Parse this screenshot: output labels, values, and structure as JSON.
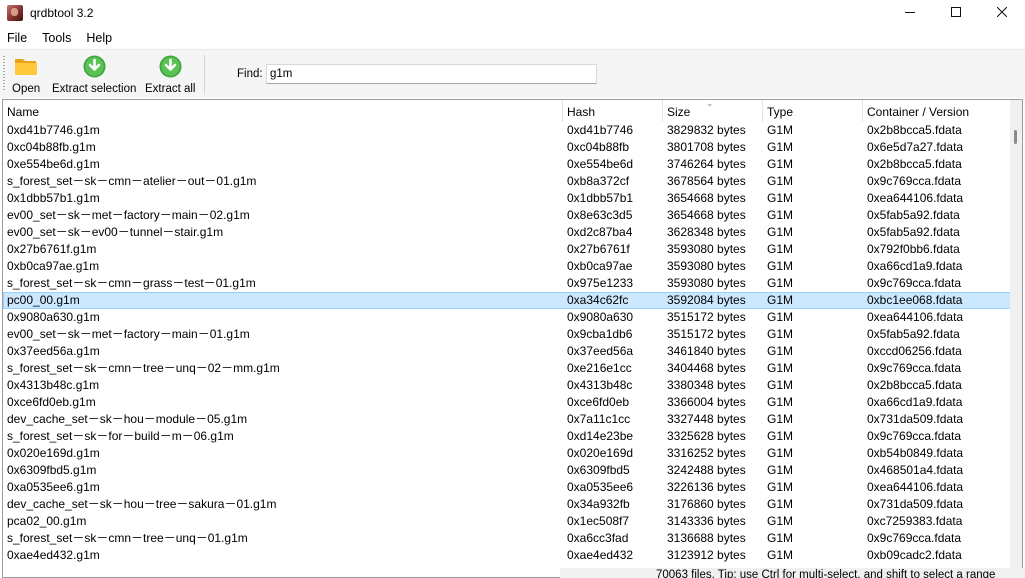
{
  "window": {
    "title": "qrdbtool 3.2",
    "controls": [
      "—",
      "☐",
      "✕"
    ]
  },
  "menu": [
    "File",
    "Tools",
    "Help"
  ],
  "toolbar": {
    "open_label": "Open",
    "extract_selection_label": "Extract selection",
    "extract_all_label": "Extract all",
    "find_label": "Find:",
    "find_value": "g1m"
  },
  "columns": [
    "Name",
    "Hash",
    "Size",
    "Type",
    "Container / Version"
  ],
  "sorted_column": "Size",
  "selected_row": 10,
  "rows": [
    [
      "0xd41b7746.g1m",
      "0xd41b7746",
      "3829832 bytes",
      "G1M",
      "0x2b8bcca5.fdata"
    ],
    [
      "0xc04b88fb.g1m",
      "0xc04b88fb",
      "3801708 bytes",
      "G1M",
      "0x6e5d7a27.fdata"
    ],
    [
      "0xe554be6d.g1m",
      "0xe554be6d",
      "3746264 bytes",
      "G1M",
      "0x2b8bcca5.fdata"
    ],
    [
      "s_forest_set－sk－cmn－atelier－out－01.g1m",
      "0xb8a372cf",
      "3678564 bytes",
      "G1M",
      "0x9c769cca.fdata"
    ],
    [
      "0x1dbb57b1.g1m",
      "0x1dbb57b1",
      "3654668 bytes",
      "G1M",
      "0xea644106.fdata"
    ],
    [
      "ev00_set－sk－met－factory－main－02.g1m",
      "0x8e63c3d5",
      "3654668 bytes",
      "G1M",
      "0x5fab5a92.fdata"
    ],
    [
      "ev00_set－sk－ev00－tunnel－stair.g1m",
      "0xd2c87ba4",
      "3628348 bytes",
      "G1M",
      "0x5fab5a92.fdata"
    ],
    [
      "0x27b6761f.g1m",
      "0x27b6761f",
      "3593080 bytes",
      "G1M",
      "0x792f0bb6.fdata"
    ],
    [
      "0xb0ca97ae.g1m",
      "0xb0ca97ae",
      "3593080 bytes",
      "G1M",
      "0xa66cd1a9.fdata"
    ],
    [
      "s_forest_set－sk－cmn－grass－test－01.g1m",
      "0x975e1233",
      "3593080 bytes",
      "G1M",
      "0x9c769cca.fdata"
    ],
    [
      "pc00_00.g1m",
      "0xa34c62fc",
      "3592084 bytes",
      "G1M",
      "0xbc1ee068.fdata"
    ],
    [
      "0x9080a630.g1m",
      "0x9080a630",
      "3515172 bytes",
      "G1M",
      "0xea644106.fdata"
    ],
    [
      "ev00_set－sk－met－factory－main－01.g1m",
      "0x9cba1db6",
      "3515172 bytes",
      "G1M",
      "0x5fab5a92.fdata"
    ],
    [
      "0x37eed56a.g1m",
      "0x37eed56a",
      "3461840 bytes",
      "G1M",
      "0xccd06256.fdata"
    ],
    [
      "s_forest_set－sk－cmn－tree－unq－02－mm.g1m",
      "0xe216e1cc",
      "3404468 bytes",
      "G1M",
      "0x9c769cca.fdata"
    ],
    [
      "0x4313b48c.g1m",
      "0x4313b48c",
      "3380348 bytes",
      "G1M",
      "0x2b8bcca5.fdata"
    ],
    [
      "0xce6fd0eb.g1m",
      "0xce6fd0eb",
      "3366004 bytes",
      "G1M",
      "0xa66cd1a9.fdata"
    ],
    [
      "dev_cache_set－sk－hou－module－05.g1m",
      "0x7a11c1cc",
      "3327448 bytes",
      "G1M",
      "0x731da509.fdata"
    ],
    [
      "s_forest_set－sk－for－build－m－06.g1m",
      "0xd14e23be",
      "3325628 bytes",
      "G1M",
      "0x9c769cca.fdata"
    ],
    [
      "0x020e169d.g1m",
      "0x020e169d",
      "3316252 bytes",
      "G1M",
      "0xb54b0849.fdata"
    ],
    [
      "0x6309fbd5.g1m",
      "0x6309fbd5",
      "3242488 bytes",
      "G1M",
      "0x468501a4.fdata"
    ],
    [
      "0xa0535ee6.g1m",
      "0xa0535ee6",
      "3226136 bytes",
      "G1M",
      "0xea644106.fdata"
    ],
    [
      "dev_cache_set－sk－hou－tree－sakura－01.g1m",
      "0x34a932fb",
      "3176860 bytes",
      "G1M",
      "0x731da509.fdata"
    ],
    [
      "pca02_00.g1m",
      "0x1ec508f7",
      "3143336 bytes",
      "G1M",
      "0xc7259383.fdata"
    ],
    [
      "s_forest_set－sk－cmn－tree－unq－01.g1m",
      "0xa6cc3fad",
      "3136688 bytes",
      "G1M",
      "0x9c769cca.fdata"
    ],
    [
      "0xae4ed432.g1m",
      "0xae4ed432",
      "3123912 bytes",
      "G1M",
      "0xb09cadc2.fdata"
    ]
  ],
  "status": "70063 files. Tip: use Ctrl for multi-select, and shift to select a range"
}
